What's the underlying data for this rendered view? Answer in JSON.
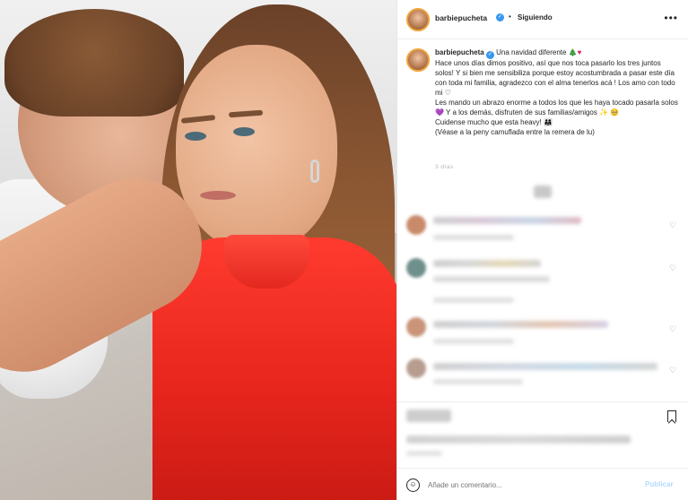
{
  "header": {
    "username": "barbiepucheta",
    "separator": "•",
    "follow_label": "Siguiendo",
    "more_icon": "more-icon"
  },
  "caption": {
    "username": "barbiepucheta",
    "title": "Una navidad diferente",
    "line1": "Hace unos días dimos positivo, así que nos toca pasarlo los tres juntos solos! Y si bien me sensibiliza porque estoy acostumbrada a pasar este día con toda mi familia, agradezco con el alma tenerlos acá ! Los amo con todo mi",
    "line2": "Les mando un abrazo enorme a todos los que les haya tocado pasarla solos",
    "line2b": "Y a los demás, disfruten de sus familias/amigos",
    "line3": "Cuidense mucho que esta heavy!",
    "line4": "(Véase a la peny camuflada entre la remera de lu)",
    "emojis": {
      "tree": "🎄",
      "heart": "♥",
      "white_heart": "♡",
      "purple_heart": "💜",
      "sparkle": "✨",
      "face": "🥺",
      "family": "👨‍👩‍👧"
    }
  },
  "time_label": "3 días",
  "comment_input": {
    "placeholder": "Añade un comentario..."
  },
  "publish_label": "Publicar",
  "colors": {
    "accent": "#3797f0",
    "publish_disabled": "#b3dbff",
    "dress": "#e8261d"
  }
}
